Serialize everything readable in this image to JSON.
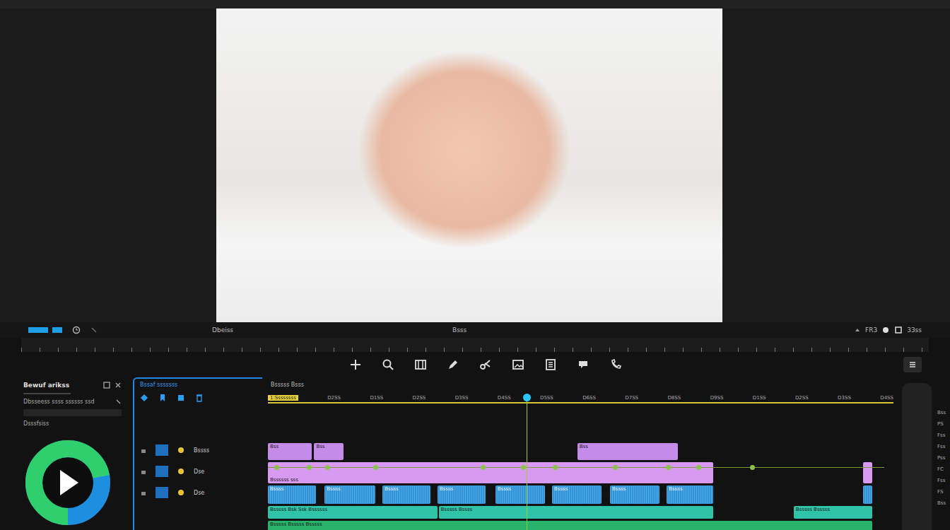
{
  "toolbar": {
    "left_label": "Dbeiss",
    "center_label": "Bsss",
    "right_labels": [
      "FR3",
      "33ss"
    ]
  },
  "effects_panel": {
    "title": "Bewuf arikss",
    "rows": [
      "Dbsseess ssss ssssss ssd",
      "Dsssfsiss"
    ],
    "level": 0.72
  },
  "tracks_panel": {
    "title": "Bssaf sssssss",
    "rows": [
      {
        "label": "Bssss"
      },
      {
        "label": "Dse"
      },
      {
        "label": "Dse"
      }
    ]
  },
  "timeline": {
    "title": "Bsssss Bsss",
    "start_label": "1:Ssssssss",
    "ruler_labels": [
      "D2SS",
      "D1SS",
      "D2SS",
      "D3SS",
      "D4SS",
      "D5SS",
      "D6SS",
      "D7SS",
      "D8SS",
      "D9SS",
      "D1SS",
      "D2SS",
      "D3SS",
      "D4SS"
    ],
    "playhead": 41.4,
    "tracks": [
      {
        "kind": "clips",
        "color": "#c58be8",
        "clips": [
          {
            "start": 0,
            "duration": 7.1,
            "label": "Bss"
          },
          {
            "start": 7.5,
            "duration": 4.8,
            "label": "Bss"
          },
          {
            "start": 50.2,
            "duration": 16.3,
            "label": "Bss"
          }
        ]
      },
      {
        "kind": "keyframes",
        "color": "#d79af0",
        "clips": [
          {
            "start": 0,
            "duration": 72.2,
            "label": "Bssssss sss"
          },
          {
            "start": 96.6,
            "duration": 1.4,
            "label": ""
          }
        ],
        "keyframes": [
          1.4,
          6.7,
          9.6,
          17.4,
          34.9,
          41.4,
          46.6,
          56.3,
          64.9,
          69.8,
          78.6
        ]
      },
      {
        "kind": "waveform",
        "color": "#2f95d8",
        "clips": [
          {
            "start": 0,
            "duration": 7.8,
            "label": "Bssss"
          },
          {
            "start": 9.2,
            "duration": 8.2,
            "label": "Bssss"
          },
          {
            "start": 18.6,
            "duration": 7.8,
            "label": "Bssss"
          },
          {
            "start": 27.5,
            "duration": 7.8,
            "label": "Bssss"
          },
          {
            "start": 36.9,
            "duration": 8.0,
            "label": "Bssss"
          },
          {
            "start": 46.1,
            "duration": 8.0,
            "label": "Bssss"
          },
          {
            "start": 55.5,
            "duration": 8.0,
            "label": "Bssss"
          },
          {
            "start": 64.7,
            "duration": 7.5,
            "label": "Bssss"
          },
          {
            "start": 96.6,
            "duration": 1.4,
            "label": ""
          }
        ]
      },
      {
        "kind": "bars",
        "color": "#2fc4a8",
        "clips": [
          {
            "start": 0,
            "duration": 27.5,
            "label": "Bsssss Bsk Ssk Bssssss"
          },
          {
            "start": 27.7,
            "duration": 44.5,
            "label": "Bsssss Bssss"
          },
          {
            "start": 85.3,
            "duration": 12.7,
            "label": "Bsssss Bsssss"
          }
        ]
      },
      {
        "kind": "bars",
        "color": "#27b36a",
        "clips": [
          {
            "start": 0,
            "duration": 98,
            "label": "Bsssss Bsssss Bsssss"
          }
        ]
      }
    ]
  },
  "side_labels": [
    "Bss",
    "PS",
    "Fss",
    "Fss",
    "Pss",
    "FC",
    "Fss",
    "FS",
    "Bss"
  ]
}
